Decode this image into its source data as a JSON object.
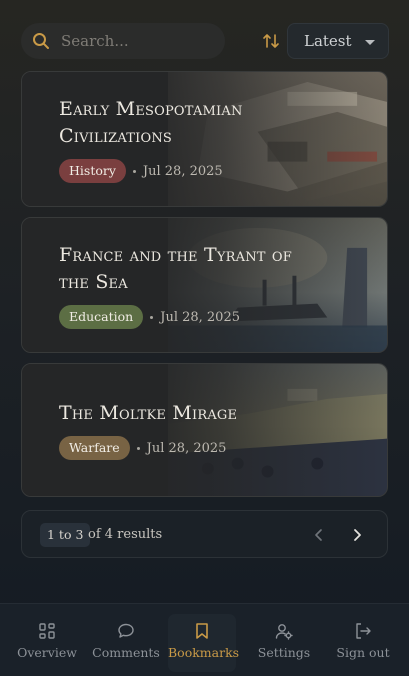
{
  "search": {
    "placeholder": "Search...",
    "value": ""
  },
  "sort": {
    "selected": "Latest"
  },
  "colors": {
    "accent": "#c99a47",
    "history": "#7a3f3f",
    "education": "#5c6e44",
    "warfare": "#786344"
  },
  "cards": [
    {
      "title": "Early Mesopotamian Civilizations",
      "tag": "History",
      "date": "Jul 28, 2025"
    },
    {
      "title": "France and the Tyrant of the Sea",
      "tag": "Education",
      "date": "Jul 28, 2025"
    },
    {
      "title": "The Moltke Mirage",
      "tag": "Warfare",
      "date": "Jul 28, 2025"
    }
  ],
  "pagination": {
    "range": "1 to 3",
    "results": "of 4 results"
  },
  "nav": [
    {
      "label": "Overview",
      "icon": "grid-icon"
    },
    {
      "label": "Comments",
      "icon": "chat-bubble-icon"
    },
    {
      "label": "Bookmarks",
      "icon": "bookmark-icon",
      "active": true
    },
    {
      "label": "Settings",
      "icon": "user-gear-icon"
    },
    {
      "label": "Sign out",
      "icon": "sign-out-icon"
    }
  ]
}
